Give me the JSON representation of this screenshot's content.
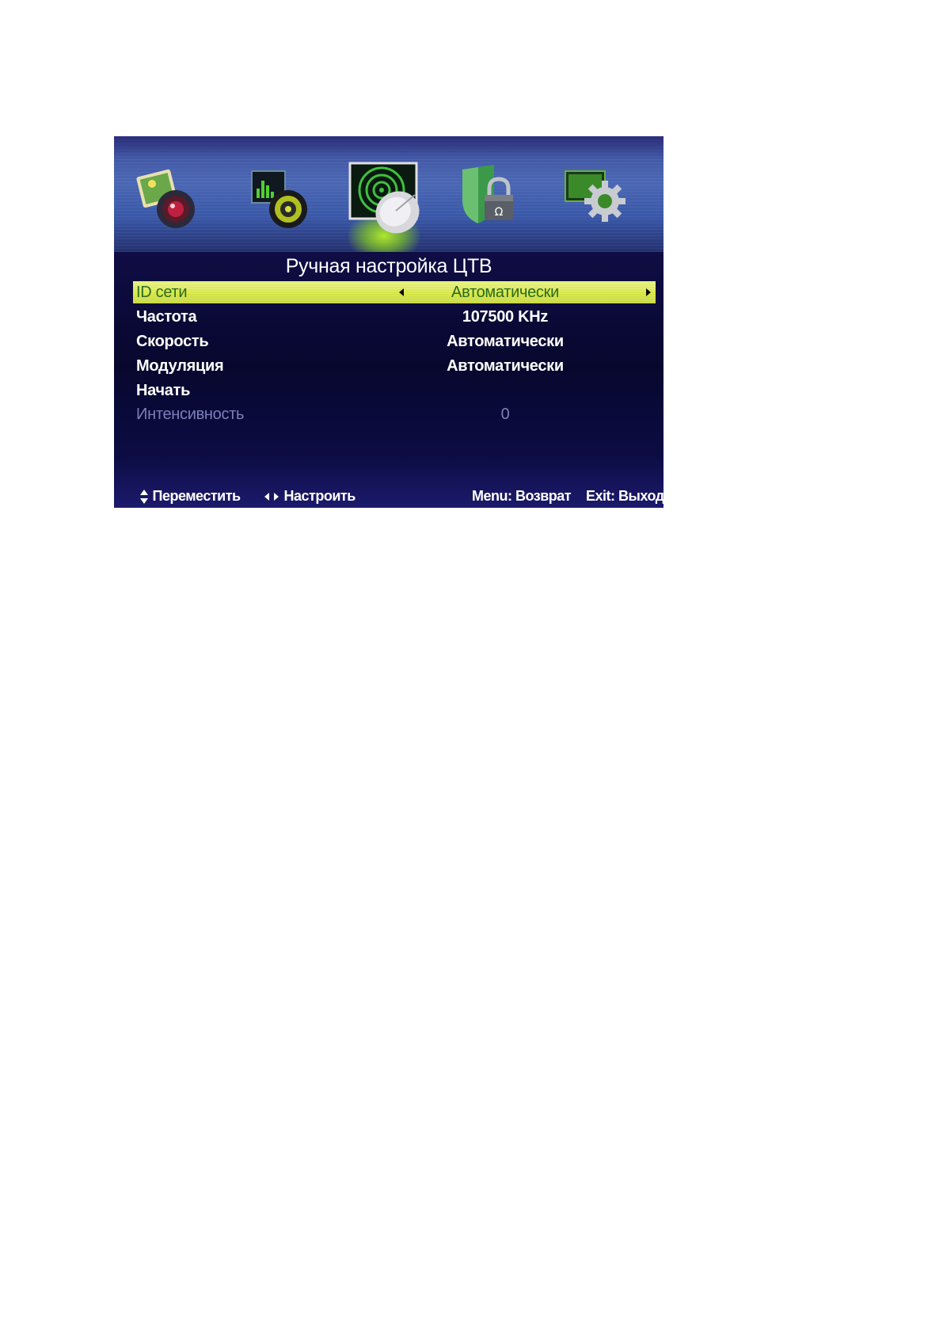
{
  "icons": [
    {
      "name": "picture-icon"
    },
    {
      "name": "sound-icon"
    },
    {
      "name": "channel-icon",
      "active": true
    },
    {
      "name": "lock-icon"
    },
    {
      "name": "setup-icon"
    }
  ],
  "menu": {
    "title": "Ручная настройка ЦТВ",
    "rows": [
      {
        "label": "ID сети",
        "value": "Автоматически",
        "state": "selected"
      },
      {
        "label": "Частота",
        "value": "107500 KHz",
        "state": "normal"
      },
      {
        "label": "Скорость",
        "value": "Автоматически",
        "state": "normal"
      },
      {
        "label": "Модуляция",
        "value": "Автоматически",
        "state": "normal"
      },
      {
        "label": "Начать",
        "value": "",
        "state": "normal"
      },
      {
        "label": "Интенсивность",
        "value": "0",
        "state": "disabled"
      }
    ]
  },
  "footer": {
    "move": "Переместить",
    "adjust": "Настроить",
    "menu": "Menu: Возврат",
    "exit": "Exit: Выход"
  },
  "colors": {
    "highlight": "#d4e444",
    "background": "#0d0a3c",
    "active_glow": "#b4f028"
  }
}
